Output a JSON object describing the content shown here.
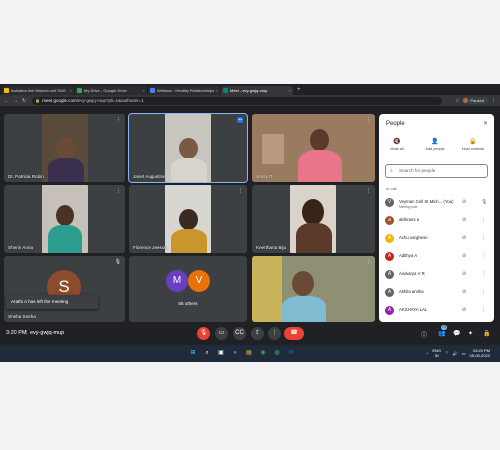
{
  "browser": {
    "tabs": [
      {
        "label": "Invitation link Women cell SNG",
        "color": "#fbbc04",
        "active": false
      },
      {
        "label": "My Drive - Google Drive",
        "color": "#34a853",
        "active": false
      },
      {
        "label": "Webinar - Healthy Relationships",
        "color": "#4285f4",
        "active": false
      },
      {
        "label": "Meet - evy-gwjq-mup",
        "color": "#00897b",
        "active": true
      }
    ],
    "new_tab": "+",
    "url_host": "meet.google.com",
    "url_path": "/evy-gwjq-mup?pli=1&authuser=1",
    "profile_label": "Paused"
  },
  "tiles": [
    {
      "name": "Dr. Patricia Robin"
    },
    {
      "name": "Janet Augustine"
    },
    {
      "name": "Jessy G"
    },
    {
      "name": "Sherin Anna"
    },
    {
      "name": "Florence Jeeson"
    },
    {
      "name": "Keerthana Biju"
    },
    {
      "name": "Sneha Sneha",
      "avatar_letter": "S",
      "avatar_color": "#8d4b2e"
    },
    {
      "name": "65 others",
      "avatars": [
        {
          "letter": "M",
          "color": "#6a3fbf"
        },
        {
          "letter": "V",
          "color": "#e8710a"
        }
      ]
    },
    {
      "name": ""
    }
  ],
  "toast": "Arathi A has left the meeting",
  "people_panel": {
    "title": "People",
    "actions": [
      "Mute all",
      "Add people",
      "Host controls"
    ],
    "search_placeholder": "Search for people",
    "section": "In call",
    "participants": [
      {
        "name": "Veyman Cell St.Mich... (You)",
        "sub": "Meeting host",
        "letter": "V",
        "color": "#5f6368"
      },
      {
        "name": "abhirami a",
        "sub": "",
        "letter": "a",
        "color": "#a0522d"
      },
      {
        "name": "Achu varghese",
        "sub": "",
        "letter": "A",
        "color": "#f4b400"
      },
      {
        "name": "Adithya A",
        "sub": "",
        "letter": "A",
        "color": "#c5221f"
      },
      {
        "name": "Aiswarya V R",
        "sub": "",
        "letter": "A",
        "color": "#5f6368"
      },
      {
        "name": "Akhila anitha",
        "sub": "",
        "letter": "A",
        "color": "#5f6368"
      },
      {
        "name": "AKSHAYA LAL",
        "sub": "",
        "letter": "A",
        "color": "#8e24aa"
      }
    ]
  },
  "bottom_bar": {
    "time": "3:20 PM",
    "separator": "|",
    "meeting_code": "evy-gwjq-mup",
    "participant_count": "73"
  },
  "taskbar": {
    "lang": "ENG",
    "region": "IN",
    "clock_time": "03:20 PM",
    "clock_date": "05-05-2022"
  }
}
